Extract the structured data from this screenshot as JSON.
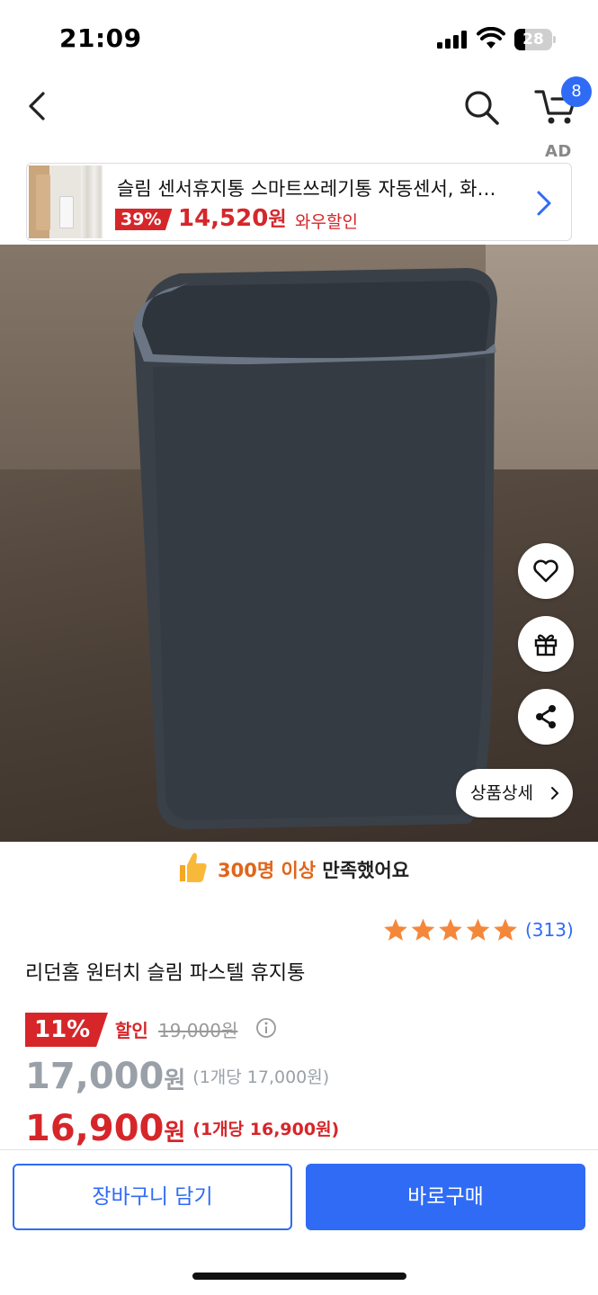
{
  "status_bar": {
    "time": "21:09",
    "battery": "28",
    "battery_fraction": 0.28
  },
  "nav": {
    "cart_count": "8",
    "back_icon": "chevron-left-icon",
    "search_icon": "search-icon",
    "cart_icon": "cart-icon"
  },
  "ad": {
    "label": "AD",
    "title": "슬림 센서휴지통 스마트쓰레기통 자동센서, 화…",
    "discount": "39%",
    "price": "14,520",
    "price_unit": "원",
    "promo": "와우할인"
  },
  "product": {
    "detail_button": "상품상세",
    "satisfaction_count": "300명 이상",
    "satisfaction_suffix": "만족했어요",
    "rating_value": 5,
    "rating_count": "(313)",
    "title": "리던홈 원터치 슬림 파스텔 휴지통",
    "discount_rate": "11%",
    "discount_label": "할인",
    "original_price": "19,000원",
    "price": "17,000",
    "price_unit": "원",
    "price_per": "(1개당 17,000원)",
    "sale_price": "16,900",
    "sale_unit": "원",
    "sale_per": "(1개당 16,900원)"
  },
  "actions": {
    "add_to_cart": "장바구니 담기",
    "buy_now": "바로구매"
  },
  "colors": {
    "accent_blue": "#2f6bf5",
    "sale_red": "#d6262a",
    "star_orange": "#f5873a"
  }
}
